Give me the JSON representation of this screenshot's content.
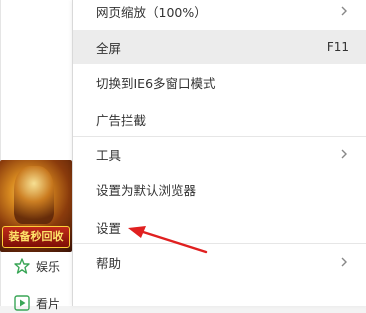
{
  "menu": {
    "items": [
      {
        "label": "网页缩放（100%）",
        "has_submenu": true
      },
      {
        "label": "全屏",
        "shortcut": "F11",
        "highlighted": true
      },
      {
        "label": "切换到IE6多窗口模式"
      },
      {
        "label": "广告拦截"
      },
      {
        "label": "工具",
        "has_submenu": true
      },
      {
        "label": "设置为默认浏览器"
      },
      {
        "label": "设置"
      },
      {
        "label": "帮助",
        "has_submenu": true
      }
    ]
  },
  "left": {
    "ad_banner": "装备秒回收",
    "entertainment_label": "娱乐",
    "partial_label": "看片",
    "star_color": "#3aa657"
  },
  "annotation": {
    "arrow_color": "#e02020"
  }
}
